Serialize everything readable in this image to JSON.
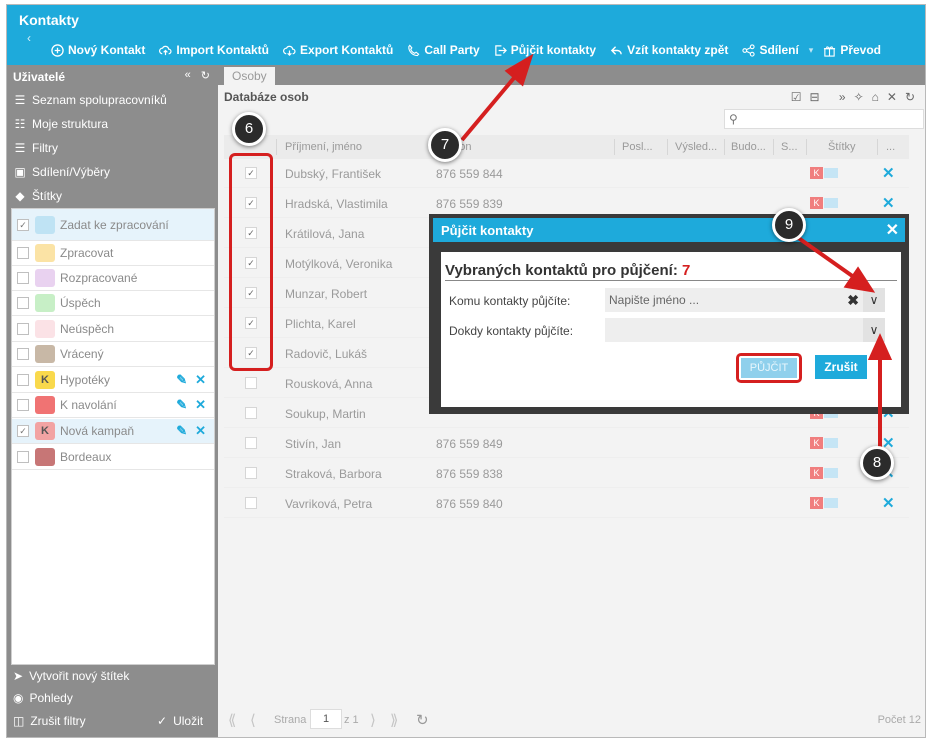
{
  "app": {
    "title": "Kontakty"
  },
  "toolbar": {
    "items": [
      {
        "label": "Nový Kontakt",
        "icon": "plus-circle-icon"
      },
      {
        "label": "Import Kontaktů",
        "icon": "cloud-upload-icon"
      },
      {
        "label": "Export Kontaktů",
        "icon": "cloud-download-icon"
      },
      {
        "label": "Call Party",
        "icon": "phone-icon"
      },
      {
        "label": "Půjčit kontakty",
        "icon": "share-out-icon"
      },
      {
        "label": "Vzít kontakty zpět",
        "icon": "reply-icon"
      },
      {
        "label": "Sdílení",
        "icon": "share-nodes-icon"
      },
      {
        "label": "Převod",
        "icon": "gift-icon"
      }
    ]
  },
  "sidebar": {
    "title": "Uživatelé",
    "nav": [
      {
        "label": "Seznam spolupracovníků",
        "icon": "list-icon"
      },
      {
        "label": "Moje struktura",
        "icon": "hierarchy-icon"
      },
      {
        "label": "Filtry",
        "icon": "layers-icon"
      },
      {
        "label": "Sdílení/Výběry",
        "icon": "inbox-icon"
      },
      {
        "label": "Štítky",
        "icon": "tags-icon"
      }
    ],
    "labels": [
      {
        "text": "Zadat ke zpracování",
        "color": "#bfe3f4",
        "letter": "",
        "checked": true,
        "selected": true
      },
      {
        "text": "Zpracovat",
        "color": "#fbe3a5",
        "letter": "",
        "checked": false,
        "selected": false
      },
      {
        "text": "Rozpracované",
        "color": "#e9d2f0",
        "letter": "",
        "checked": false,
        "selected": false
      },
      {
        "text": "Úspěch",
        "color": "#c7efc6",
        "letter": "",
        "checked": false,
        "selected": false
      },
      {
        "text": "Neúspěch",
        "color": "#fbe2e6",
        "letter": "",
        "checked": false,
        "selected": false
      },
      {
        "text": "Vrácený",
        "color": "#c8b8a6",
        "letter": "",
        "checked": false,
        "selected": false
      },
      {
        "text": "Hypotéky",
        "color": "#f9d94c",
        "letter": "K",
        "checked": false,
        "selected": false
      },
      {
        "text": "K navolání",
        "color": "#f07373",
        "letter": "",
        "checked": false,
        "selected": false
      },
      {
        "text": "Nová kampaň",
        "color": "#f2a3a3",
        "letter": "K",
        "checked": true,
        "selected": true
      },
      {
        "text": "Bordeaux",
        "color": "#c77676",
        "letter": "",
        "checked": false,
        "selected": false
      }
    ],
    "footer": {
      "new_label": "Vytvořit nový štítek",
      "views": "Pohledy",
      "clear": "Zrušit filtry",
      "save": "Uložit"
    }
  },
  "main": {
    "tab": "Osoby",
    "grid_title": "Databáze osob",
    "columns": [
      "Příjmení, jméno",
      "Telefon",
      "Posl...",
      "Výsled...",
      "Budo...",
      "S...",
      "Štítky",
      "..."
    ],
    "rows": [
      {
        "name": "Dubský, František",
        "phone": "876 559 844",
        "checked": true
      },
      {
        "name": "Hradská, Vlastimila",
        "phone": "876 559 839",
        "checked": true
      },
      {
        "name": "Krátilová, Jana",
        "phone": "",
        "checked": true
      },
      {
        "name": "Motýlková, Veronika",
        "phone": "",
        "checked": true
      },
      {
        "name": "Munzar, Robert",
        "phone": "",
        "checked": true
      },
      {
        "name": "Plichta, Karel",
        "phone": "",
        "checked": true
      },
      {
        "name": "Radovič, Lukáš",
        "phone": "",
        "checked": true
      },
      {
        "name": "Rousková, Anna",
        "phone": "",
        "checked": false
      },
      {
        "name": "Soukup, Martin",
        "phone": "",
        "checked": false
      },
      {
        "name": "Stivín, Jan",
        "phone": "876 559 849",
        "checked": false
      },
      {
        "name": "Straková, Barbora",
        "phone": "876 559 838",
        "checked": false
      },
      {
        "name": "Vavriková, Petra",
        "phone": "876 559 840",
        "checked": false
      }
    ],
    "pager": {
      "page_label": "Strana",
      "page": "1",
      "of": "z 1",
      "count": "Počet 12"
    }
  },
  "dialog": {
    "title": "Půjčit kontakty",
    "heading": "Vybraných kontaktů pro půjčení:",
    "count": "7",
    "field1_label": "Komu kontakty půjčíte:",
    "field1_placeholder": "Napište jméno ...",
    "field2_label": "Dokdy kontakty půjčíte:",
    "borrow_button": "PŮJČIT",
    "cancel_button": "Zrušit"
  },
  "annotations": {
    "step6": "6",
    "step7": "7",
    "step8": "8",
    "step9": "9",
    "color": "#d51f1f"
  }
}
